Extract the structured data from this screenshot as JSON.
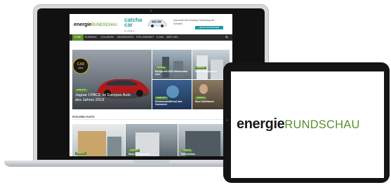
{
  "site": {
    "logo_part1": "energie",
    "logo_part2": "RUNDSCHAU"
  },
  "ad": {
    "brand": "catcha car",
    "brand_sub": "by carafino",
    "text": "Das erste free-floating Carsharing der Schweiz",
    "cta": "JETZT ENTDECKEN"
  },
  "nav": {
    "items": [
      "HOME",
      "RUBRIKEN",
      "KOLUMNEN",
      "MEDIENDATEN",
      "STELLENMARKT",
      "E-MAIL",
      "ÜBER UNS"
    ]
  },
  "hero": {
    "badge": "MOBILITÄT",
    "caption_line1": "Jaguar I-PACE ist Europas Auto",
    "caption_line2": "des Jahres 2019"
  },
  "tiles": [
    {
      "badge": "ENERGIE",
      "caption": "Europa will 2050 klimaneutral sein"
    },
    {
      "badge": "ENERGIE",
      "caption": "Neue Stadtquartiere"
    },
    {
      "badge": "MOBILITÄT",
      "caption": "Elektromobilität auf dem Vormarsch"
    },
    {
      "badge": "ENERGIE",
      "caption": "Neue Kollektoren"
    }
  ],
  "featured": {
    "label": "FEATURED POSTS",
    "cards": [
      {
        "badge": "ENERGIE"
      },
      {
        "badge": "ENERGIE",
        "caption": "Neue Stadtquartiere"
      },
      {
        "badge": "ENERGIE",
        "caption": "Gewerbebau"
      }
    ]
  },
  "tablet": {
    "logo_part1": "energie",
    "logo_part2": "RUNDSCHAU"
  },
  "colors": {
    "brand_green": "#5a8f2a",
    "nav_dark": "#2b2b2b",
    "ad_teal": "#1c9aa4"
  }
}
